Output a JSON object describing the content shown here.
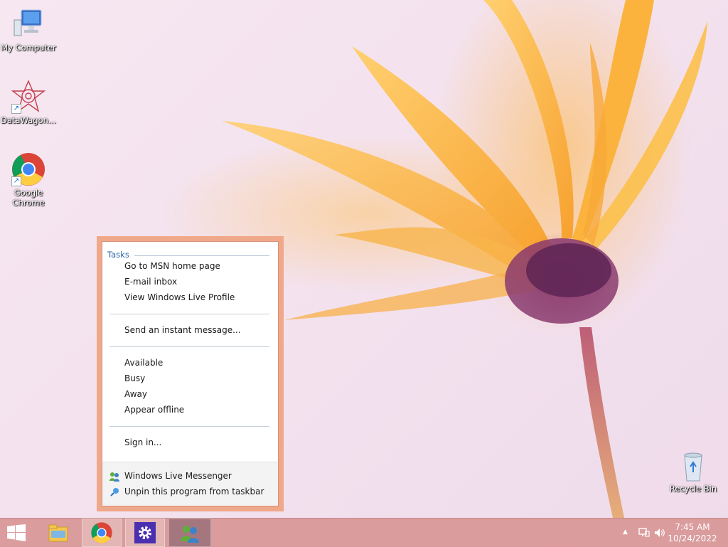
{
  "desktop": {
    "icons": [
      {
        "label": "My Computer",
        "icon": "my-computer-icon"
      },
      {
        "label": "DataWagon...",
        "icon": "datawagon-icon"
      },
      {
        "label": "Google Chrome",
        "icon": "chrome-icon"
      },
      {
        "label": "Recycle Bin",
        "icon": "recycle-bin-icon"
      }
    ]
  },
  "jumplist": {
    "header": "Tasks",
    "group1": [
      "Go to MSN home page",
      "E-mail inbox",
      "View Windows Live Profile"
    ],
    "group2": [
      "Send an instant message..."
    ],
    "group3": [
      "Available",
      "Busy",
      "Away",
      "Appear offline"
    ],
    "group4": [
      "Sign in..."
    ],
    "footer": [
      {
        "label": "Windows Live Messenger",
        "icon": "messenger-icon"
      },
      {
        "label": "Unpin this program from taskbar",
        "icon": "unpin-icon"
      }
    ],
    "border_color": "#f0a88a"
  },
  "taskbar": {
    "buttons": [
      {
        "icon": "windows-logo-icon"
      },
      {
        "icon": "file-explorer-icon"
      },
      {
        "icon": "chrome-icon"
      },
      {
        "icon": "settings-gear-icon"
      },
      {
        "icon": "messenger-icon"
      }
    ],
    "tray": {
      "show_hidden_icon": "chevron-up-icon",
      "network_icon": "network-icon",
      "volume_icon": "volume-icon"
    },
    "clock": {
      "time": "7:45 AM",
      "date": "10/24/2022"
    },
    "color": "#d89696"
  }
}
